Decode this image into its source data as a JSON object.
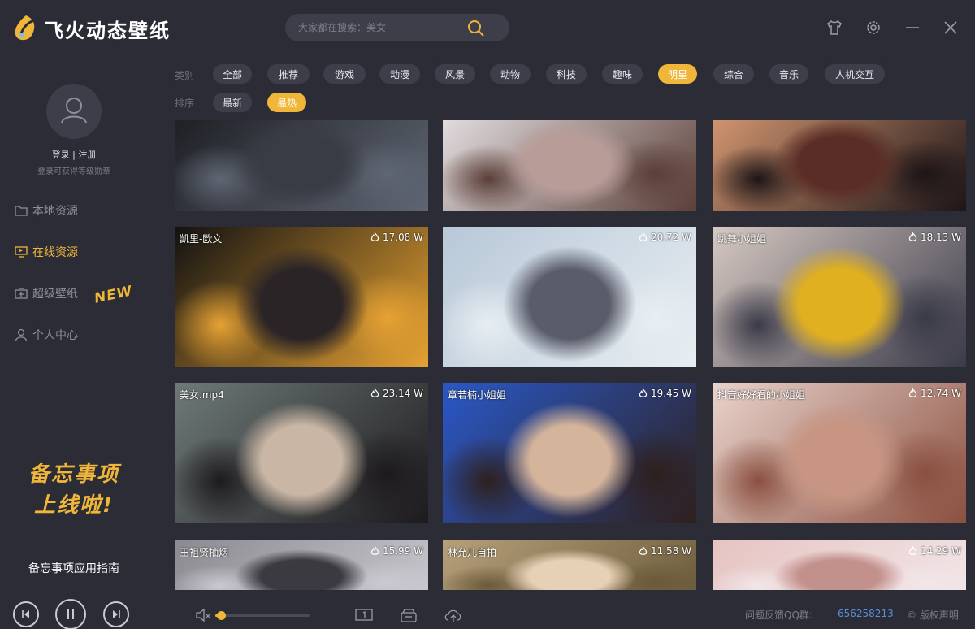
{
  "app": {
    "title": "飞火动态壁纸"
  },
  "search": {
    "placeholder": "大家都在搜索：美女"
  },
  "user": {
    "login": "登录 | 注册",
    "hint": "登录可获得等级勋章"
  },
  "nav": [
    {
      "label": "本地资源",
      "icon": "folder-icon",
      "active": false
    },
    {
      "label": "在线资源",
      "icon": "monitor-icon",
      "active": true
    },
    {
      "label": "超级壁纸",
      "icon": "super-wallpaper-icon",
      "active": false
    },
    {
      "label": "个人中心",
      "icon": "user-icon",
      "active": false
    }
  ],
  "new_badge": "NEW",
  "promo": {
    "line1": "备忘事项",
    "line2": "上线啦!",
    "guide": "备忘事项应用指南"
  },
  "filters": {
    "category_label": "类别",
    "categories": [
      "全部",
      "推荐",
      "游戏",
      "动漫",
      "风景",
      "动物",
      "科技",
      "趣味",
      "明星",
      "综合",
      "音乐",
      "人机交互"
    ],
    "active_category": "明星",
    "sort_label": "排序",
    "sorts": [
      "最新",
      "最热"
    ],
    "active_sort": "最热"
  },
  "wallpapers": [
    {
      "title": "",
      "heat": "",
      "palette": [
        "#1c1d22",
        "#3a3c45",
        "#5f6673"
      ]
    },
    {
      "title": "",
      "heat": "",
      "palette": [
        "#e7e3e6",
        "#b89c98",
        "#5b3f38"
      ]
    },
    {
      "title": "",
      "heat": "",
      "palette": [
        "#d99a74",
        "#5a2e26",
        "#1d1517"
      ]
    },
    {
      "title": "凯里-欧文",
      "heat": "17.08 W",
      "palette": [
        "#121212",
        "#2a2427",
        "#e6a233"
      ]
    },
    {
      "title": "",
      "heat": "20.72 W",
      "palette": [
        "#b8c8d8",
        "#5a5c6a",
        "#e8eef2"
      ]
    },
    {
      "title": "跳舞小姐姐",
      "heat": "18.13 W",
      "palette": [
        "#d7c9c2",
        "#e0b020",
        "#3a3a48"
      ]
    },
    {
      "title": "美女.mp4",
      "heat": "23.14 W",
      "palette": [
        "#6e7a78",
        "#c9b6a4",
        "#1d1a1d"
      ]
    },
    {
      "title": "章若楠小姐姐",
      "heat": "19.45 W",
      "palette": [
        "#2a58c8",
        "#d4b49a",
        "#2e201d"
      ]
    },
    {
      "title": "抖音好好看的小姐姐",
      "heat": "12.74 W",
      "palette": [
        "#e9d3cc",
        "#c79582",
        "#8a5040"
      ]
    },
    {
      "title": "王祖贤抽烟",
      "heat": "15.99 W",
      "palette": [
        "#8a8a90",
        "#3a3a40",
        "#c9c9cf"
      ]
    },
    {
      "title": "林允儿自拍",
      "heat": "11.58 W",
      "palette": [
        "#b6a07a",
        "#e6d0b6",
        "#6a5a3a"
      ]
    },
    {
      "title": "",
      "heat": "14.29 W",
      "palette": [
        "#e6c4c2",
        "#c2918c",
        "#f2e6e8"
      ]
    }
  ],
  "bottom": {
    "qq_label": "问题反馈QQ群:",
    "qq_number": "656258213",
    "copyright": "© 版权声明",
    "volume": 0.05
  },
  "colors": {
    "accent": "#f0b63a",
    "background": "#2b2c36",
    "chip": "#3d3e4a",
    "link": "#5a8ed8"
  }
}
